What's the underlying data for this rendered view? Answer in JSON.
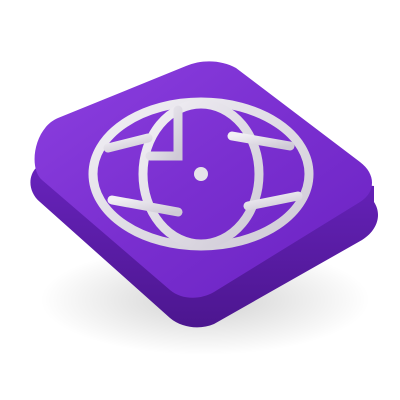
{
  "icon": {
    "name": "globe-icon",
    "tile_color": "#7a2fd0",
    "tile_side_color": "#5a1ea6",
    "glyph_color": "#e6e3ea"
  }
}
